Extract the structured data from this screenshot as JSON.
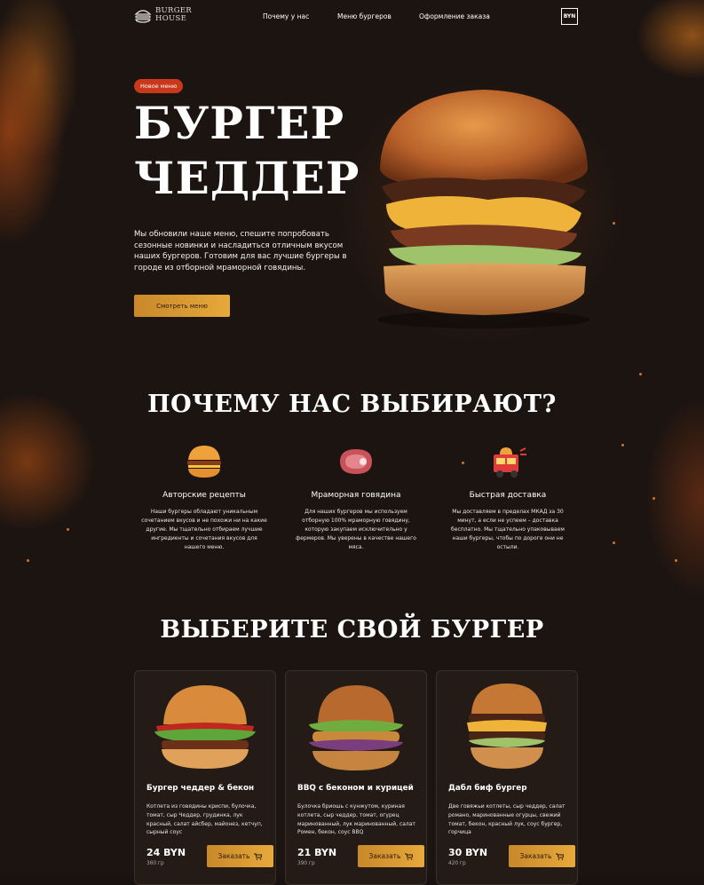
{
  "brand": {
    "line1": "BURGER",
    "line2": "HOUSE"
  },
  "nav": {
    "items": [
      "Почему у нас",
      "Меню бургеров",
      "Оформление заказа"
    ],
    "currency": "BYN"
  },
  "hero": {
    "badge": "Новое меню",
    "title_line1": "БУРГЕР",
    "title_line2": "ЧЕДДЕР",
    "text": "Мы обновили наше меню, спешите попробовать сезонные новинки и насладиться отличным вкусом наших бургеров. Готовим для вас лучшие бургеры в городе из отборной мраморной говядины.",
    "button": "Смотреть меню"
  },
  "why": {
    "heading": "ПОЧЕМУ НАС ВЫБИРАЮТ?",
    "features": [
      {
        "icon": "burger-icon",
        "title": "Авторские рецепты",
        "text": "Наши бургеры обладают уникальным сочетанием вкусов и не похожи ни на какие другие. Мы тщательно отбираем лучшие ингредиенты и сочетания вкусов для нашего меню."
      },
      {
        "icon": "steak-icon",
        "title": "Мраморная говядина",
        "text": "Для наших бургеров мы используем отборную 100% мраморную говядину, которую закупаем исключительно у фермеров. Мы уверены в качестве нашего мяса."
      },
      {
        "icon": "delivery-truck-icon",
        "title": "Быстрая доставка",
        "text": "Мы доставляем в пределах МКАД за 30 минут, а если не успеем – доставка бесплатно. Мы тщательно упаковываем наши бургеры, чтобы по дороге они не остыли."
      }
    ]
  },
  "products": {
    "heading": "ВЫБЕРИТЕ СВОЙ БУРГЕР",
    "cart_icon": "cart-icon",
    "items": [
      {
        "title": "Бургер чеддер & бекон",
        "desc": "Котлета из говядины криспи, булочка, томат, сыр Чеддер, грудинка, лук красный, салат айсбер, майонез, кетчуп, сырный соус",
        "price": "24 BYN",
        "weight": "360 гр",
        "button": "Заказать"
      },
      {
        "title": "BBQ с беконом и курицей",
        "desc": "Булочка бриошь с кунжутом, куриная котлета, сыр чеддер, томат, огурец маринованный, лук маринованный, салат Ромен, бекон, соус BBQ",
        "price": "21 BYN",
        "weight": "390 гр",
        "button": "Заказать"
      },
      {
        "title": "Дабл биф бургер",
        "desc": "Две говяжьи котлеты, сыр чеддер, салат романо, маринованные огурцы, свежий томат, бекон, красный лук, соус бургер, горчица",
        "price": "30 BYN",
        "weight": "420 гр",
        "button": "Заказать"
      }
    ]
  },
  "colors": {
    "accent": "#e0a03a",
    "badge": "#c9381b",
    "background": "#1c1411",
    "card": "#241b17"
  }
}
